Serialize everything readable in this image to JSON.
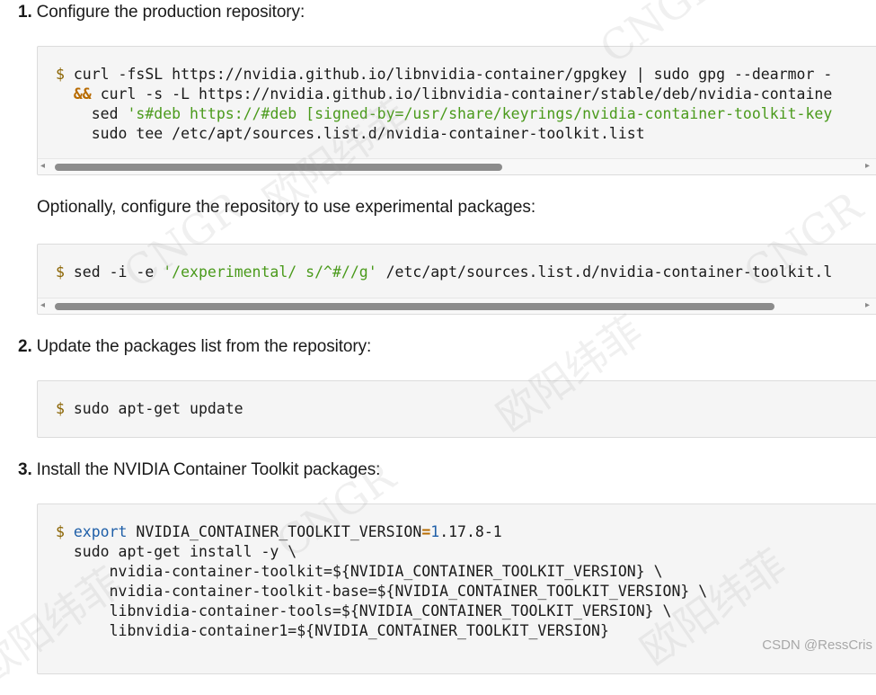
{
  "steps": [
    {
      "number": "1.",
      "text": "Configure the production repository:"
    },
    {
      "number": "2.",
      "text": "Update the packages list from the repository:"
    },
    {
      "number": "3.",
      "text": "Install the NVIDIA Container Toolkit packages:"
    }
  ],
  "optional_note": "Optionally, configure the repository to use experimental packages:",
  "code": {
    "repo": {
      "prompt": "$",
      "line1": "curl -fsSL https://nvidia.github.io/libnvidia-container/gpgkey | sudo gpg --dearmor -",
      "line2_op": "&&",
      "line2": "curl -s -L https://nvidia.github.io/libnvidia-container/stable/deb/nvidia-containe",
      "line3_cmd": "sed",
      "line3_str": "'s#deb https://#deb [signed-by=/usr/share/keyrings/nvidia-container-toolkit-key",
      "line4": "sudo tee /etc/apt/sources.list.d/nvidia-container-toolkit.list"
    },
    "experimental": {
      "prompt": "$",
      "cmd": "sed -i -e",
      "str": "'/experimental/ s/^#//g'",
      "rest": "/etc/apt/sources.list.d/nvidia-container-toolkit.l"
    },
    "update": {
      "prompt": "$",
      "cmd": "sudo apt-get update"
    },
    "install": {
      "prompt": "$",
      "kw": "export",
      "var": "NVIDIA_CONTAINER_TOOLKIT_VERSION",
      "eq": "=",
      "num": "1",
      "ver_rest": ".17.8-1",
      "line2": "sudo apt-get install -y \\",
      "line3": "nvidia-container-toolkit=${NVIDIA_CONTAINER_TOOLKIT_VERSION} \\",
      "line4": "nvidia-container-toolkit-base=${NVIDIA_CONTAINER_TOOLKIT_VERSION} \\",
      "line5": "libnvidia-container-tools=${NVIDIA_CONTAINER_TOOLKIT_VERSION} \\",
      "line6": "libnvidia-container1=${NVIDIA_CONTAINER_TOOLKIT_VERSION}"
    }
  },
  "scrollbars": {
    "left_arrow": "◂",
    "right_arrow": "▸",
    "repo_thumb_fraction": 0.56,
    "experimental_thumb_fraction": 0.9
  },
  "watermark": {
    "latin": "CNGR",
    "cjk": "欧阳纬菲",
    "csdn": "CSDN @RessCris"
  },
  "colors": {
    "prompt": "#8a6300",
    "string": "#4a9a1b",
    "keyword": "#1f5fa8",
    "operator": "#b86b00"
  }
}
